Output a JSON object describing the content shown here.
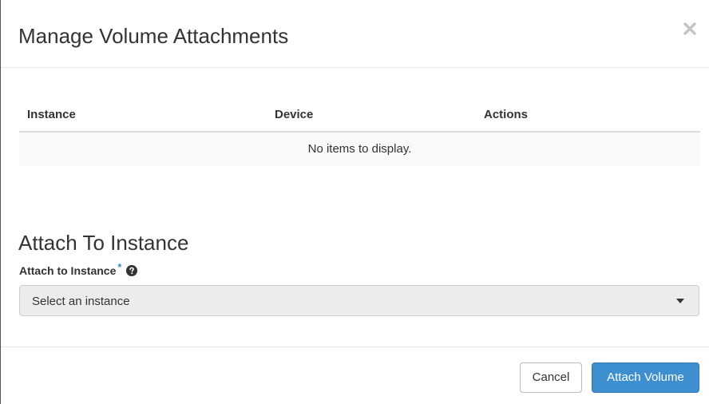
{
  "modal": {
    "title": "Manage Volume Attachments",
    "close_icon": "close-icon"
  },
  "attachments_table": {
    "columns": [
      "Instance",
      "Device",
      "Actions"
    ],
    "empty_message": "No items to display."
  },
  "attach_section": {
    "title": "Attach To Instance",
    "field_label": "Attach to Instance",
    "required_marker": "*",
    "help_icon": "question-circle-icon",
    "select_value": "Select an instance"
  },
  "footer": {
    "cancel_label": "Cancel",
    "attach_label": "Attach Volume"
  },
  "colors": {
    "primary": "#3d8fd0",
    "required": "#3c8dc9",
    "select_bg": "#ececec"
  }
}
